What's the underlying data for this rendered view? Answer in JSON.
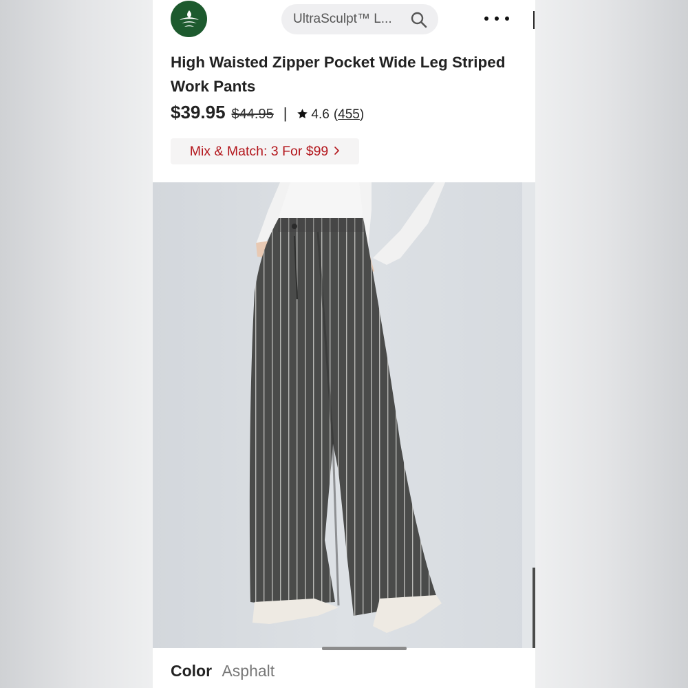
{
  "search": {
    "text": "UltraSculpt™ L..."
  },
  "product": {
    "title_line1": "High Waisted Zipper Pocket Wide Leg Striped",
    "title_line2": "Work Pants",
    "price": "$39.95",
    "original_price": "$44.95",
    "separator": "|",
    "rating": "4.6",
    "reviews_open": "(",
    "review_count": "455",
    "reviews_close": ")",
    "promo": "Mix & Match: 3 For $99",
    "color_label": "Color",
    "color_value": "Asphalt"
  },
  "gallery": {
    "current_slide_fraction": 0.22
  },
  "colors": {
    "promo_red": "#b3161c",
    "brand_green": "#1d5a2e",
    "pant_fabric": "#4a4b4a"
  },
  "icons": [
    "brand-logo-icon",
    "search-icon",
    "more-icon",
    "star-icon",
    "chevron-right-icon"
  ]
}
